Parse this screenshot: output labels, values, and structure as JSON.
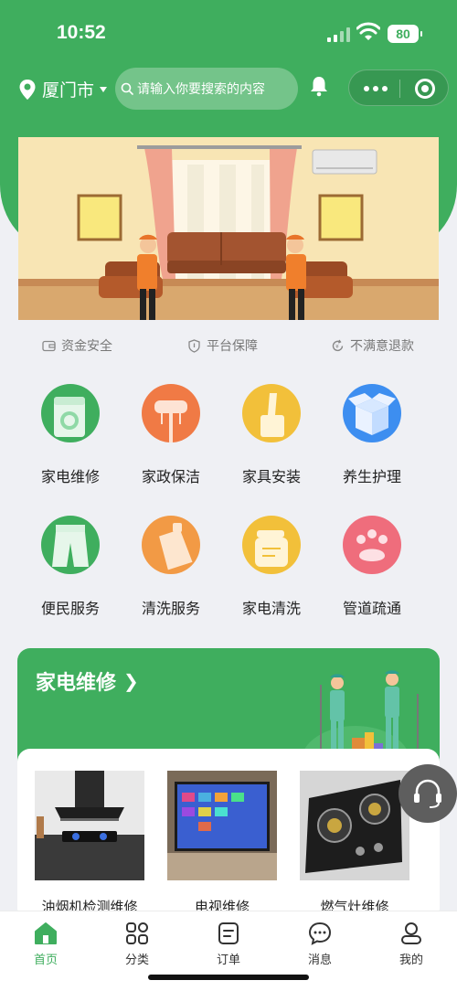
{
  "status_bar": {
    "time": "10:52",
    "battery": "80"
  },
  "header": {
    "city": "厦门市",
    "search_placeholder": "请输入你要搜索的内容"
  },
  "guarantees": [
    "资金安全",
    "平台保障",
    "不满意退款"
  ],
  "categories": [
    {
      "label": "家电维修",
      "icon": "washing-machine-icon",
      "color": "#3fae5e"
    },
    {
      "label": "家政保洁",
      "icon": "broom-icon",
      "color": "#f07a45"
    },
    {
      "label": "家具安装",
      "icon": "furniture-icon",
      "color": "#f2c03a"
    },
    {
      "label": "养生护理",
      "icon": "box-icon",
      "color": "#3d8ef0"
    },
    {
      "label": "便民服务",
      "icon": "clothing-icon",
      "color": "#3fae5e"
    },
    {
      "label": "清洗服务",
      "icon": "bottle-icon",
      "color": "#f29a45"
    },
    {
      "label": "家电清洗",
      "icon": "kettle-icon",
      "color": "#f2c03a"
    },
    {
      "label": "管道疏通",
      "icon": "paw-icon",
      "color": "#ef6d7c"
    }
  ],
  "section": {
    "title": "家电维修",
    "products": [
      {
        "name": "油烟机检测维修"
      },
      {
        "name": "电视维修"
      },
      {
        "name": "燃气灶维修"
      }
    ]
  },
  "tabbar": [
    {
      "label": "首页",
      "icon": "home-icon",
      "active": true
    },
    {
      "label": "分类",
      "icon": "grid-icon",
      "active": false
    },
    {
      "label": "订单",
      "icon": "order-icon",
      "active": false
    },
    {
      "label": "消息",
      "icon": "message-icon",
      "active": false
    },
    {
      "label": "我的",
      "icon": "user-icon",
      "active": false
    }
  ],
  "colors": {
    "brand": "#3fae5e",
    "background": "#eff0f4"
  }
}
